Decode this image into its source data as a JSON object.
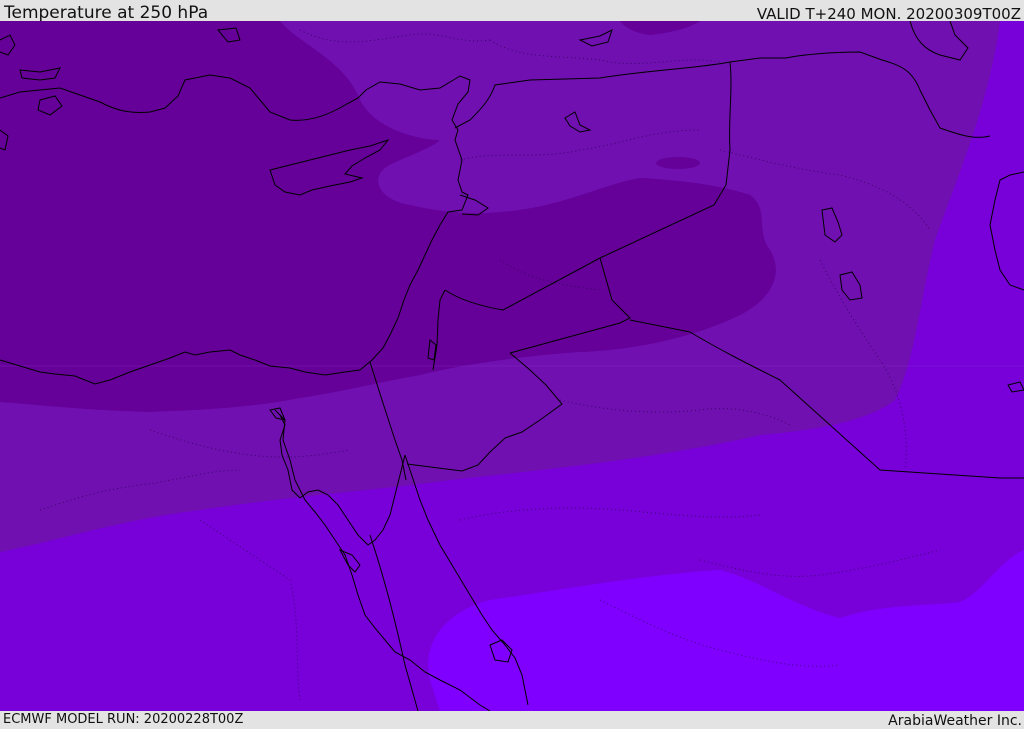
{
  "header": {
    "title": "Temperature at 250 hPa",
    "valid_time": "VALID T+240 MON. 20200309T00Z"
  },
  "footer": {
    "model_run": "ECMWF MODEL RUN: 20200228T00Z",
    "provider": "ArabiaWeather Inc."
  },
  "map": {
    "variable": "temperature",
    "level": "250 hPa",
    "colors": {
      "band_coldest": "#650098",
      "band_cold": "#7010b0",
      "band_mid": "#7800d8",
      "band_warm": "#7f00ff",
      "coastline": "#000000",
      "border": "#000000",
      "admin_boundary": "#2a0050"
    }
  }
}
